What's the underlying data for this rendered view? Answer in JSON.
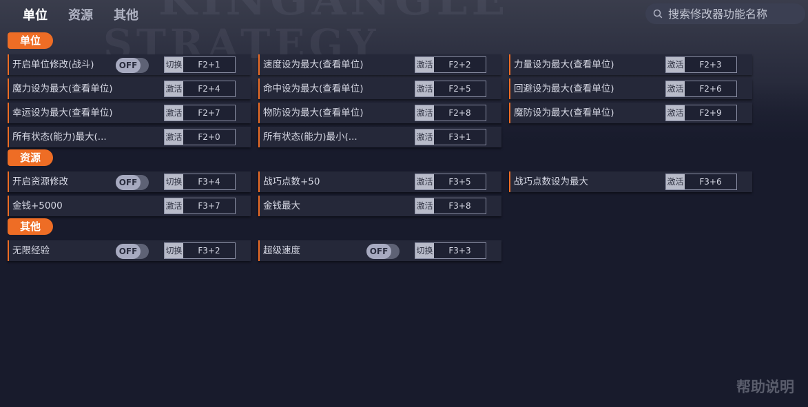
{
  "nav": {
    "tabs": [
      {
        "label": "单位",
        "active": true
      },
      {
        "label": "资源",
        "active": false
      },
      {
        "label": "其他",
        "active": false
      }
    ]
  },
  "search": {
    "placeholder": "搜索修改器功能名称"
  },
  "background": {
    "words": [
      "KINGANGLE",
      "STRATEGY"
    ]
  },
  "colors": {
    "accent": "#ee6d25",
    "panel": "#252839",
    "page": "#181b2c"
  },
  "sections": [
    {
      "title": "单位",
      "rows": [
        [
          {
            "label": "开启单位修改(战斗)",
            "toggle": "OFF",
            "action": "切换",
            "key": "F2+1"
          },
          {
            "label": "速度设为最大(查看单位)",
            "action": "激活",
            "key": "F2+2"
          },
          {
            "label": "力量设为最大(查看单位)",
            "action": "激活",
            "key": "F2+3"
          }
        ],
        [
          {
            "label": "魔力设为最大(查看单位)",
            "action": "激活",
            "key": "F2+4"
          },
          {
            "label": "命中设为最大(查看单位)",
            "action": "激活",
            "key": "F2+5"
          },
          {
            "label": "回避设为最大(查看单位)",
            "action": "激活",
            "key": "F2+6"
          }
        ],
        [
          {
            "label": "幸运设为最大(查看单位)",
            "action": "激活",
            "key": "F2+7"
          },
          {
            "label": "物防设为最大(查看单位)",
            "action": "激活",
            "key": "F2+8"
          },
          {
            "label": "魔防设为最大(查看单位)",
            "action": "激活",
            "key": "F2+9"
          }
        ],
        [
          {
            "label": "所有状态(能力)最大(...",
            "action": "激活",
            "key": "F2+0"
          },
          {
            "label": "所有状态(能力)最小(...",
            "action": "激活",
            "key": "F3+1"
          }
        ]
      ]
    },
    {
      "title": "资源",
      "rows": [
        [
          {
            "label": "开启资源修改",
            "toggle": "OFF",
            "action": "切换",
            "key": "F3+4"
          },
          {
            "label": "战巧点数+50",
            "action": "激活",
            "key": "F3+5"
          },
          {
            "label": "战巧点数设为最大",
            "action": "激活",
            "key": "F3+6"
          }
        ],
        [
          {
            "label": "金钱+5000",
            "action": "激活",
            "key": "F3+7"
          },
          {
            "label": "金钱最大",
            "action": "激活",
            "key": "F3+8"
          }
        ]
      ]
    },
    {
      "title": "其他",
      "rows": [
        [
          {
            "label": "无限经验",
            "toggle": "OFF",
            "action": "切换",
            "key": "F3+2"
          },
          {
            "label": "超级速度",
            "toggle": "OFF",
            "action": "切换",
            "key": "F3+3"
          }
        ]
      ]
    }
  ],
  "help": {
    "label": "帮助说明"
  }
}
